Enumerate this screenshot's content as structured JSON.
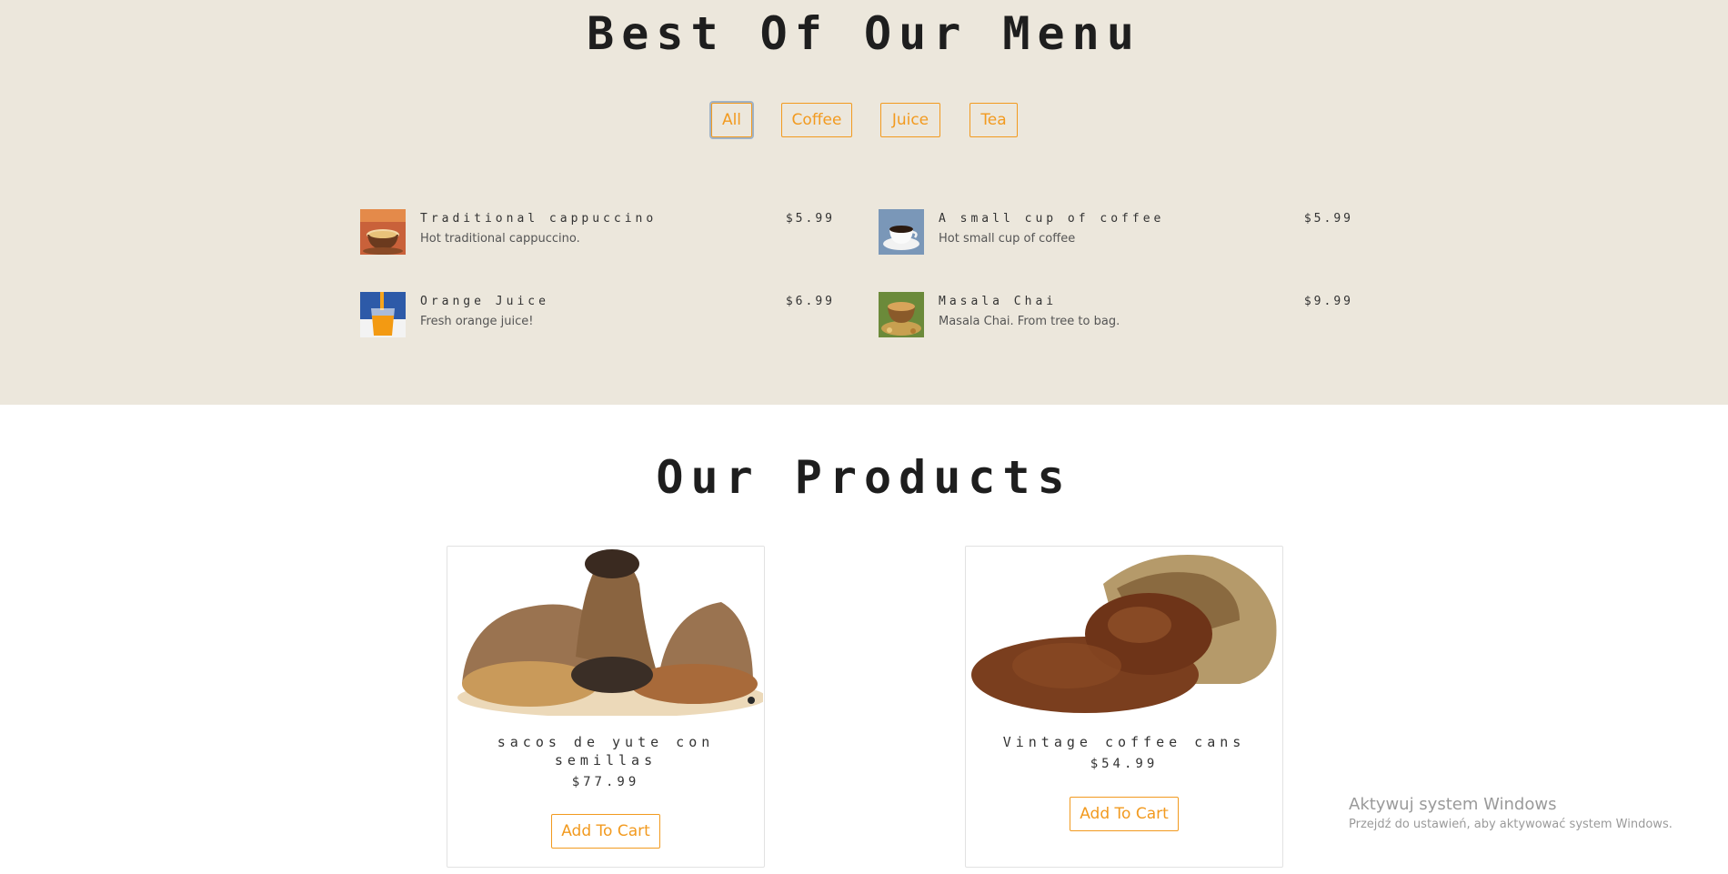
{
  "menu_section": {
    "title": "Best Of Our Menu",
    "filters": [
      {
        "label": "All",
        "active": true
      },
      {
        "label": "Coffee",
        "active": false
      },
      {
        "label": "Juice",
        "active": false
      },
      {
        "label": "Tea",
        "active": false
      }
    ],
    "items": [
      {
        "name": "Traditional cappuccino",
        "price": "$5.99",
        "description": "Hot traditional cappuccino.",
        "icon": "cappuccino-image"
      },
      {
        "name": "A small cup of coffee",
        "price": "$5.99",
        "description": "Hot small cup of coffee",
        "icon": "coffee-cup-image"
      },
      {
        "name": "Orange Juice",
        "price": "$6.99",
        "description": "Fresh orange juice!",
        "icon": "orange-juice-image"
      },
      {
        "name": "Masala Chai",
        "price": "$9.99",
        "description": "Masala Chai. From tree to bag.",
        "icon": "masala-chai-image"
      }
    ]
  },
  "products_section": {
    "title": "Our Products",
    "products": [
      {
        "name": "sacos de yute con semillas",
        "price": "$77.99",
        "button": "Add To Cart",
        "icon": "jute-sacks-seeds-image"
      },
      {
        "name": "Vintage coffee cans",
        "price": "$54.99",
        "button": "Add To Cart",
        "icon": "coffee-beans-sack-image"
      }
    ]
  },
  "windows_watermark": {
    "title": "Aktywuj system Windows",
    "subtitle": "Przejdź do ustawień, aby aktywować system Windows."
  },
  "colors": {
    "accent": "#f29a1f",
    "menu_background": "#ece7dc",
    "page_background": "#ffffff"
  }
}
